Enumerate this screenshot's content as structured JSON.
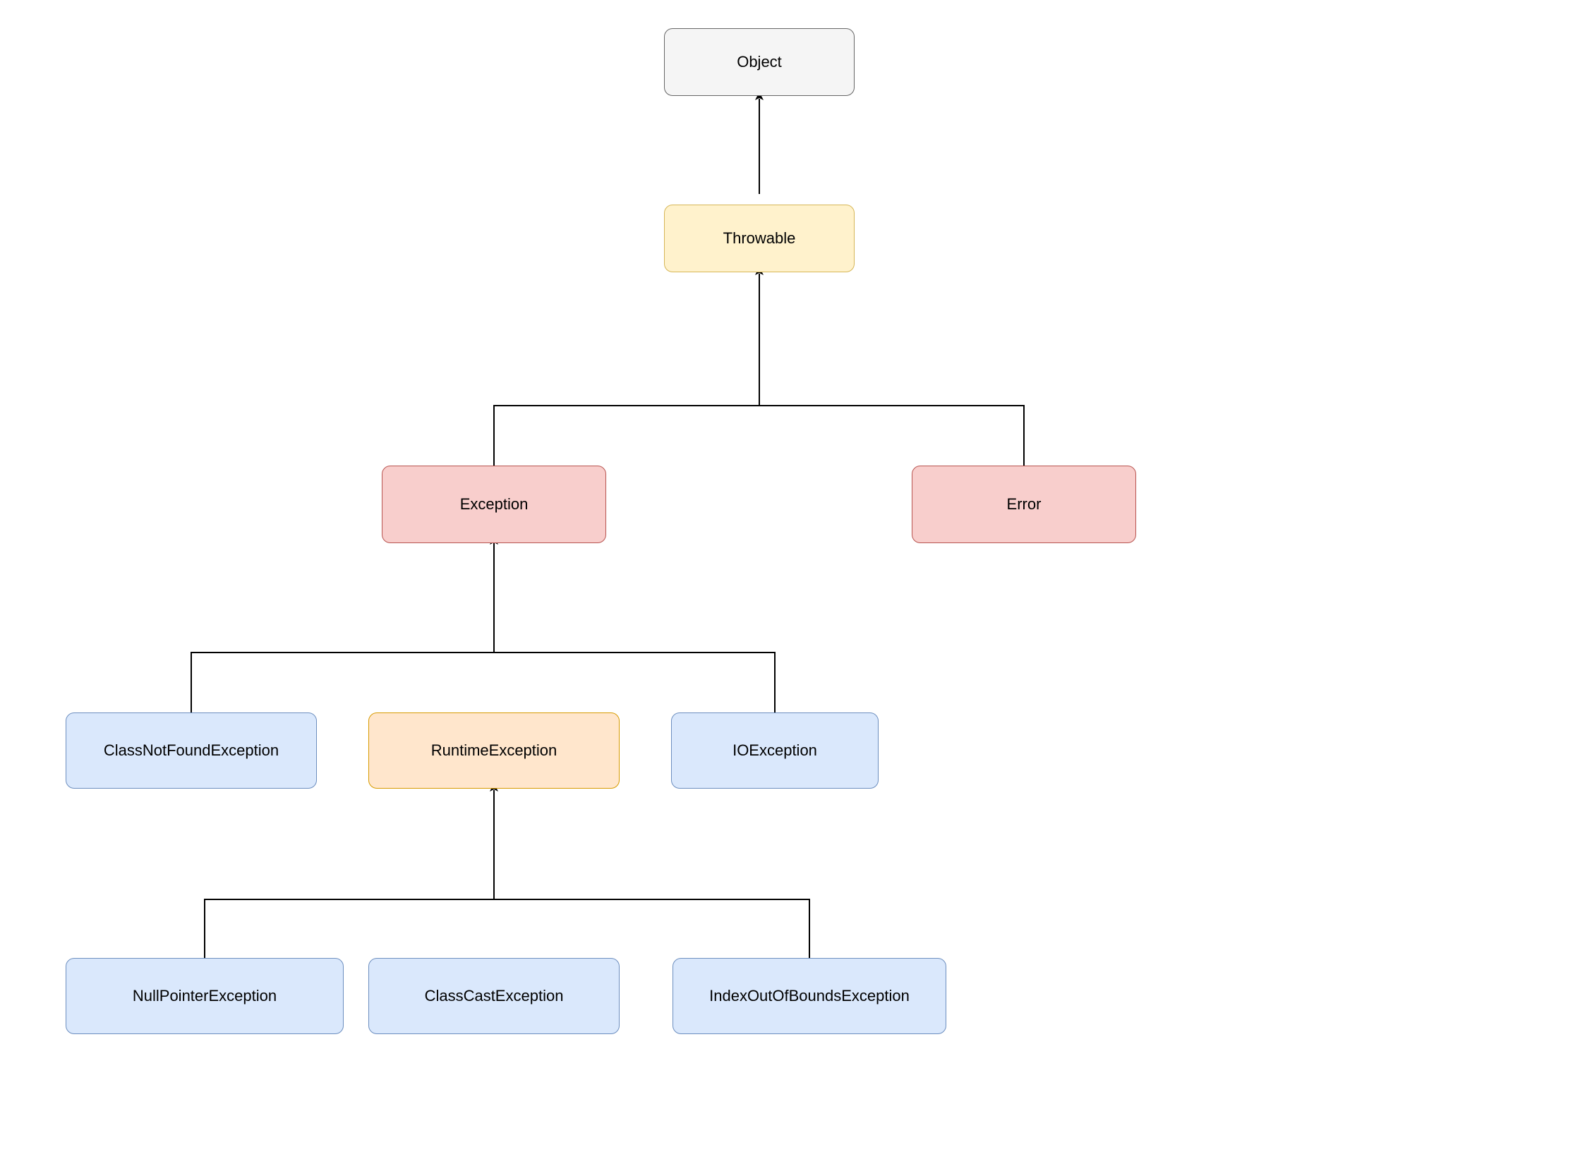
{
  "nodes": {
    "object": "Object",
    "throwable": "Throwable",
    "exception": "Exception",
    "error": "Error",
    "classNotFound": "ClassNotFoundException",
    "runtime": "RuntimeException",
    "io": "IOException",
    "nullPointer": "NullPointerException",
    "classCast": "ClassCastException",
    "indexOutOfBounds": "IndexOutOfBoundsException"
  },
  "colors": {
    "gray_fill": "#f5f5f5",
    "gray_stroke": "#666666",
    "yellow_fill": "#fff2cc",
    "yellow_stroke": "#d6b656",
    "red_fill": "#f8cecc",
    "red_stroke": "#b85450",
    "blue_fill": "#dae8fc",
    "blue_stroke": "#6c8ebf",
    "orange_fill": "#ffe6cc",
    "orange_stroke": "#d79b00"
  },
  "edges": [
    {
      "from": "throwable",
      "to": "object"
    },
    {
      "from": "exception",
      "to": "throwable"
    },
    {
      "from": "error",
      "to": "throwable"
    },
    {
      "from": "classNotFound",
      "to": "exception"
    },
    {
      "from": "runtime",
      "to": "exception"
    },
    {
      "from": "io",
      "to": "exception"
    },
    {
      "from": "nullPointer",
      "to": "runtime"
    },
    {
      "from": "classCast",
      "to": "runtime"
    },
    {
      "from": "indexOutOfBounds",
      "to": "runtime"
    }
  ]
}
